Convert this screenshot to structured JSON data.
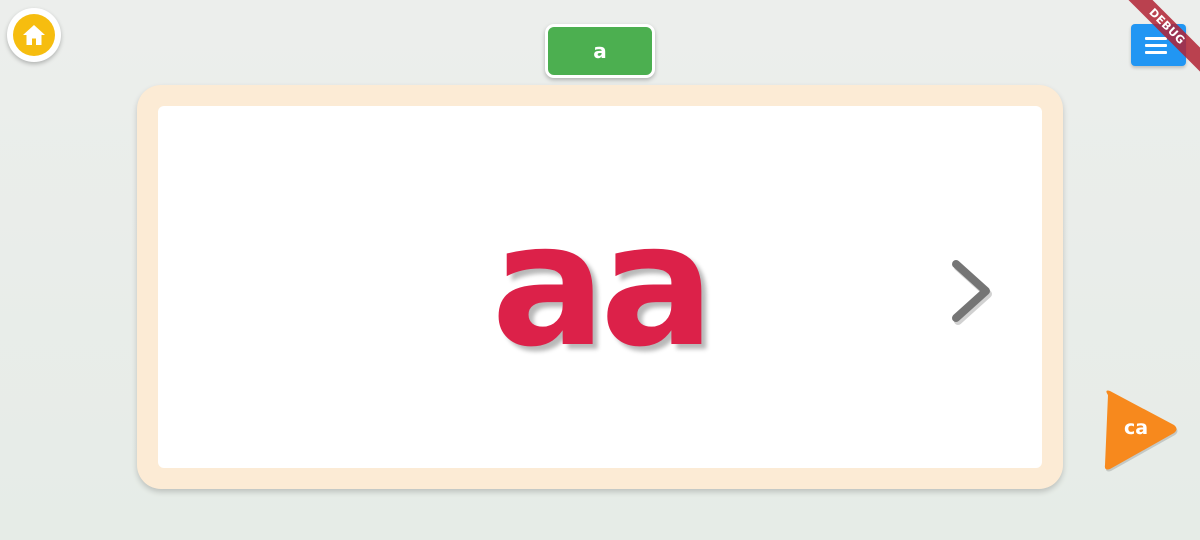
{
  "header": {
    "letter_chip": "a",
    "debug_banner": "DEBUG"
  },
  "card": {
    "word": "aa"
  },
  "play_button": {
    "label": "ca"
  },
  "colors": {
    "background": "#e8ece8",
    "home_button": "#f6bd0f",
    "letter_chip": "#4caf50",
    "menu_button": "#2196f3",
    "card_frame": "#fcebd5",
    "word_text": "#dc2149",
    "arrow": "#757575",
    "play_button": "#f7891d",
    "debug_ribbon": "#b22234"
  },
  "icons": {
    "home": "home-icon",
    "menu": "menu-icon",
    "next": "chevron-right-icon",
    "play": "play-triangle-icon"
  }
}
